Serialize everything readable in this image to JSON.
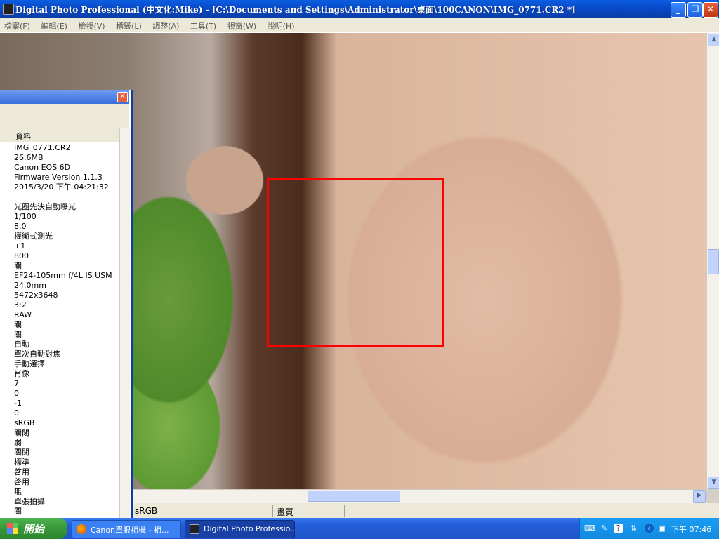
{
  "window": {
    "title": "Digital Photo Professional (中文化:Mike) - [C:\\Documents and Settings\\Administrator\\桌面\\100CANON\\IMG_0771.CR2 *]",
    "min_label": "_",
    "max_label": "❐",
    "close_label": "✕"
  },
  "menu": [
    "檔案(F)",
    "編輯(E)",
    "檢視(V)",
    "標籤(L)",
    "調整(A)",
    "工具(T)",
    "視窗(W)",
    "說明(H)"
  ],
  "info_panel": {
    "column_header": "資料",
    "close_label": "✕",
    "rows": [
      "IMG_0771.CR2",
      "26.6MB",
      "Canon EOS 6D",
      "Firmware Version 1.1.3",
      "2015/3/20 下午 04:21:32",
      "",
      "光圈先決自動曝光",
      "1/100",
      "8.0",
      "權衡式測光",
      "+1",
      "800",
      "關",
      "EF24-105mm f/4L IS USM",
      "24.0mm",
      "5472x3648",
      "3:2",
      "RAW",
      "關",
      "關",
      "自動",
      "單次自動對焦",
      "手動選擇",
      "肖像",
      "7",
      "0",
      "-1",
      "0",
      "sRGB",
      "關閉",
      "弱",
      "關閉",
      "標準",
      "啓用",
      "啓用",
      "無",
      "單張拍攝",
      "關"
    ]
  },
  "status_bar": {
    "color_space": "sRGB",
    "quality": "畫質"
  },
  "scroll": {
    "up": "▲",
    "down": "▼",
    "right": "▶"
  },
  "taskbar": {
    "start_label": "開始",
    "tasks": [
      {
        "label": "Canon單眼相機 - 相...",
        "icon": "firefox-icon"
      },
      {
        "label": "Digital Photo Professio...",
        "icon": "dpp-app-icon"
      }
    ],
    "clock": "下午 07:46"
  },
  "colors": {
    "title_bar": "#0849c8",
    "selection_box": "#ff0000",
    "taskbar": "#245edb",
    "start_button": "#3a9a3a"
  }
}
